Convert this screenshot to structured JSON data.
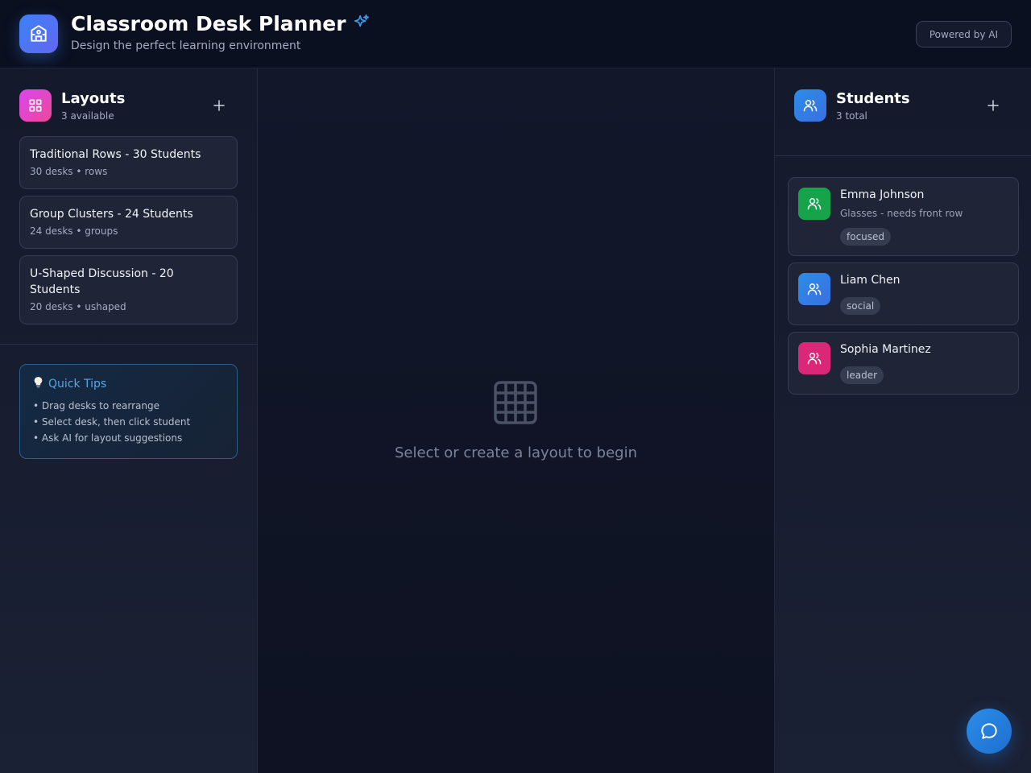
{
  "header": {
    "title": "Classroom Desk Planner",
    "subtitle": "Design the perfect learning environment",
    "powered_label": "Powered by AI"
  },
  "layouts": {
    "title": "Layouts",
    "count_label": "3 available",
    "items": [
      {
        "name": "Traditional Rows - 30 Students",
        "meta": "30 desks • rows"
      },
      {
        "name": "Group Clusters - 24 Students",
        "meta": "24 desks • groups"
      },
      {
        "name": "U-Shaped Discussion - 20 Students",
        "meta": "20 desks • ushaped"
      }
    ]
  },
  "tips": {
    "title": "Quick Tips",
    "items": [
      "Drag desks to rearrange",
      "Select desk, then click student",
      "Ask AI for layout suggestions"
    ]
  },
  "canvas": {
    "empty_message": "Select or create a layout to begin"
  },
  "students": {
    "title": "Students",
    "count_label": "3 total",
    "items": [
      {
        "name": "Emma Johnson",
        "note": "Glasses - needs front row",
        "tag": "focused",
        "color": "#16a34a"
      },
      {
        "name": "Liam Chen",
        "tag": "social",
        "color": "#2b8de8"
      },
      {
        "name": "Sophia Martinez",
        "tag": "leader",
        "color": "#db2777"
      }
    ]
  },
  "colors": {
    "accent": "#3b82f6",
    "tips_title": "#4fa8e8",
    "layouts_icon": "#d946ef",
    "students_icon": "#2b8de8"
  },
  "icons": {
    "logo": "school-icon",
    "sparkle": "sparkles-icon",
    "layouts": "grid-icon",
    "students": "users-icon",
    "add": "plus-icon",
    "tips": "lightbulb-icon",
    "empty": "table-grid-icon",
    "chat": "chat-icon"
  }
}
